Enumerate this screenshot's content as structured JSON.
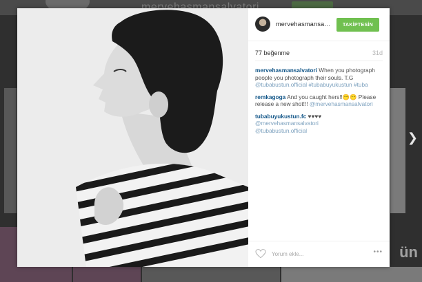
{
  "background": {
    "username": "mervehasmansalvatori"
  },
  "post": {
    "username": "mervehasmansa…",
    "follow_label": "TAKİPTESİN",
    "likes": "77 beğenme",
    "time": "31d"
  },
  "comments": [
    {
      "user": "mervehasmansalvatori",
      "text": " When you photograph people you photograph their souls. T.G ",
      "links": [
        "@tubabustun.official",
        "#tubabuyukustun",
        "#tuba"
      ]
    },
    {
      "user": "remkagoga",
      "text": " And you caught hers!!😶😶 Please release a new shot!!! ",
      "links": [
        "@mervehasmansalvatori"
      ]
    },
    {
      "user": "tubabuyukustun.fc",
      "text": " ♥♥♥♥ ",
      "links": [
        "@mervehasmansalvatori",
        "@tubabustun.official"
      ]
    }
  ],
  "comment_input": {
    "placeholder": "Yorum ekle..."
  },
  "more_label": "•••",
  "nav": {
    "next_arrow": "❯"
  },
  "watermark": "ün",
  "colors": {
    "follow_green": "#70c050",
    "username_blue": "#125688",
    "link_blue": "#7ea2bf"
  }
}
